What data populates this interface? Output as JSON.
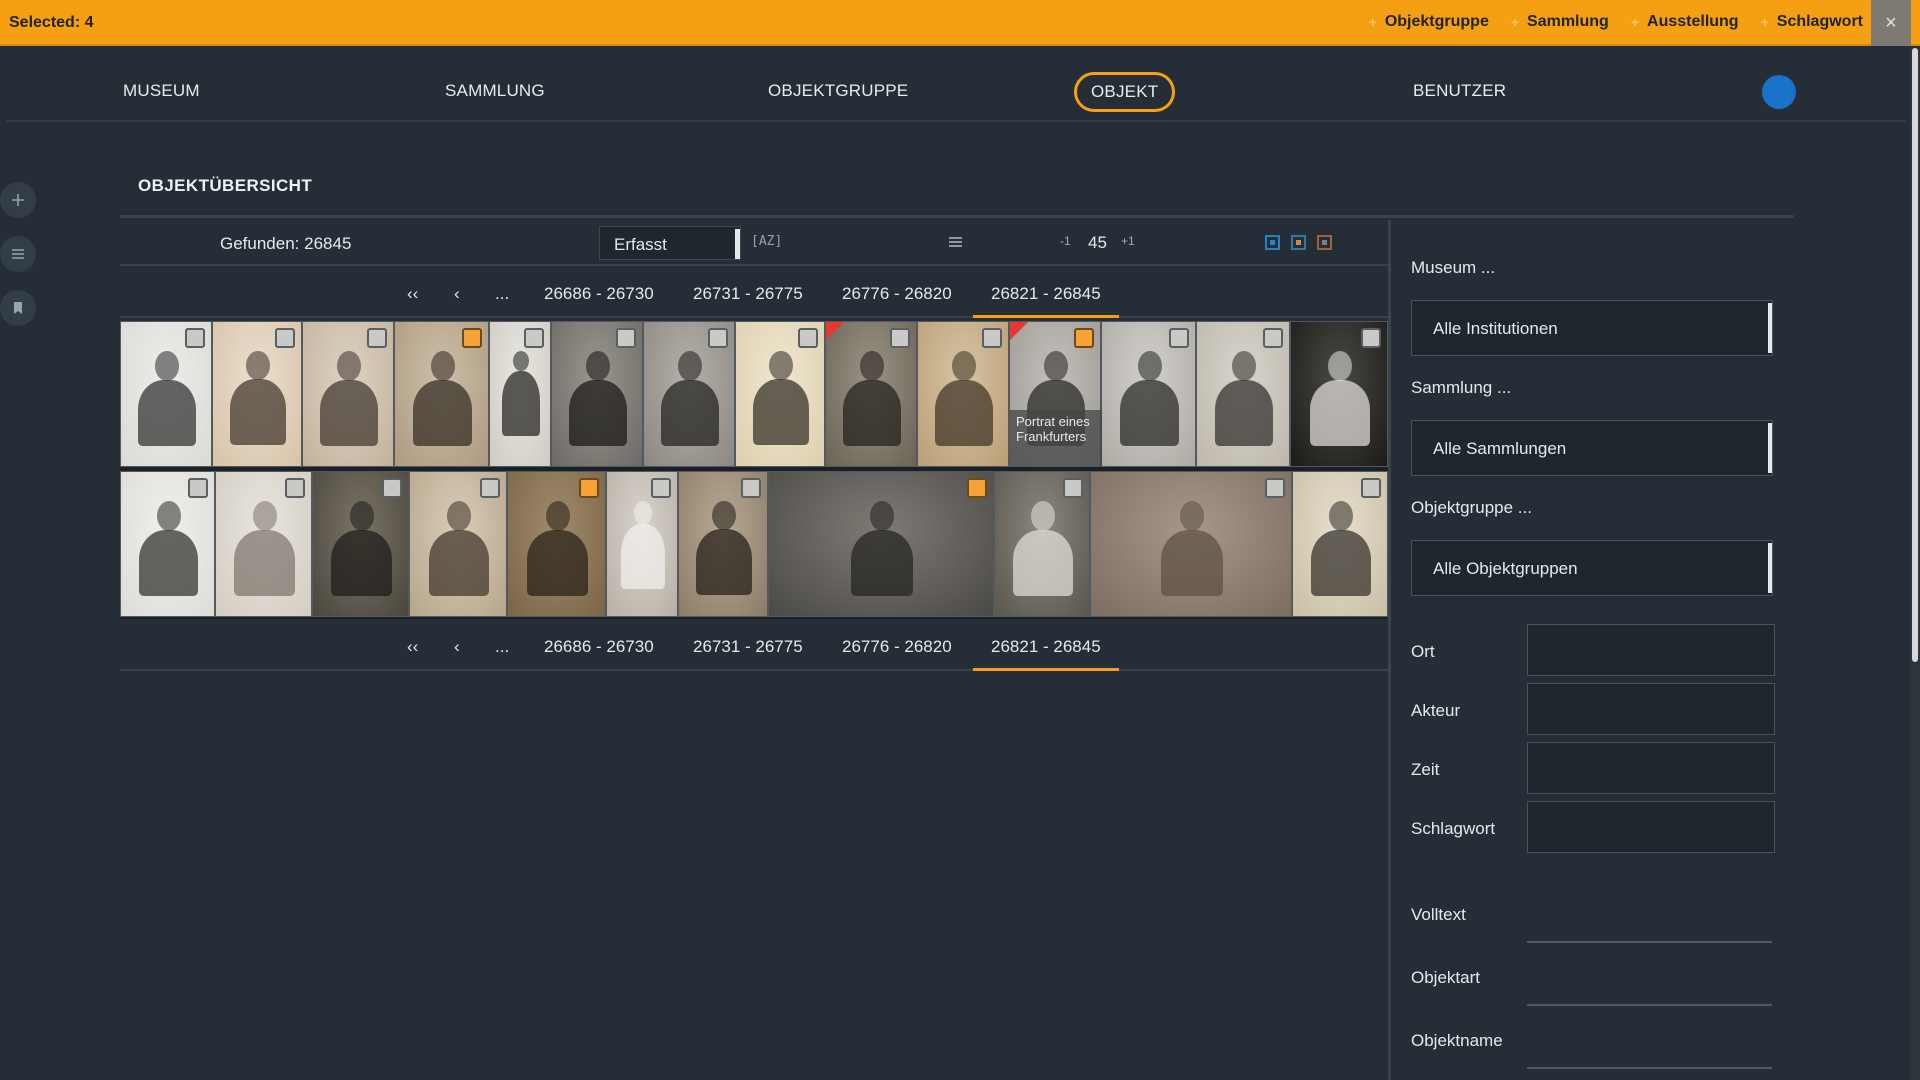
{
  "selection_bar": {
    "count_label": "Selected: 4",
    "actions": [
      "Objektgruppe",
      "Sammlung",
      "Ausstellung",
      "Schlagwort"
    ],
    "close": "×"
  },
  "nav": {
    "items": [
      "MUSEUM",
      "SAMMLUNG",
      "OBJEKTGRUPPE",
      "OBJEKT",
      "BENUTZER"
    ],
    "active": "OBJEKT"
  },
  "page": {
    "title": "OBJEKTÜBERSICHT"
  },
  "toolbar": {
    "found": "Gefunden: 26845",
    "sort_value": "Erfasst",
    "az_label": "[AZ]",
    "page_minus": "-1",
    "page_number": "45",
    "page_plus": "+1"
  },
  "pagination": {
    "first": "‹‹",
    "prev": "‹",
    "ellipsis": "...",
    "ranges": [
      "26686 - 26730",
      "26731 - 26775",
      "26776 - 26820",
      "26821 - 26845"
    ],
    "active_range": "26821 - 26845"
  },
  "thumbnails": {
    "tooltip_text": "Portrat eines Frankfurters",
    "selected_count_visible": 4
  },
  "filters": {
    "museum_label": "Museum ...",
    "museum_value": "Alle Institutionen",
    "sammlung_label": "Sammlung ...",
    "sammlung_value": "Alle Sammlungen",
    "objektgruppe_label": "Objektgruppe ...",
    "objektgruppe_value": "Alle Objektgruppen",
    "ort_label": "Ort",
    "akteur_label": "Akteur",
    "zeit_label": "Zeit",
    "schlagwort_label": "Schlagwort",
    "volltext_label": "Volltext",
    "objektart_label": "Objektart",
    "objektname_label": "Objektname"
  },
  "colors": {
    "accent": "#f5a013",
    "background": "#252e36",
    "avatar": "#1b72c9",
    "flag": "#e3392f"
  },
  "icons": [
    "plus-icon",
    "list-icon",
    "bookmark-icon",
    "close-icon",
    "sort-az-icon",
    "list-view-icon",
    "grid-view-icon"
  ]
}
